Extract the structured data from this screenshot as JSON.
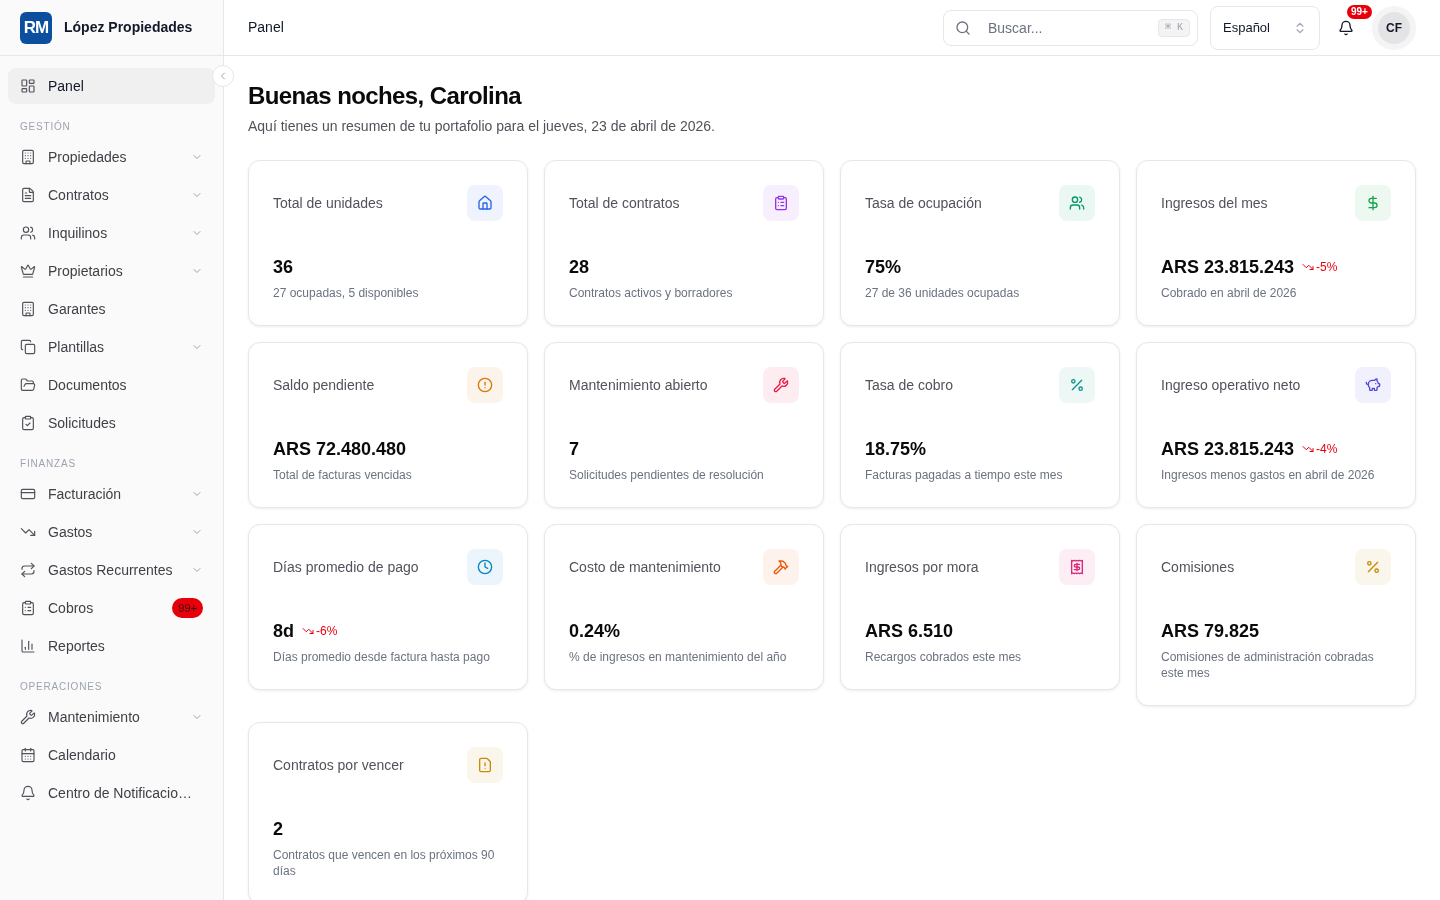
{
  "sidebar": {
    "logo": "RM",
    "brand": "López Propiedades",
    "items": [
      {
        "label": "Panel",
        "selected": true,
        "expandable": false
      }
    ],
    "sections": [
      {
        "title": "GESTIÓN",
        "items": [
          {
            "label": "Propiedades",
            "selected": false,
            "expandable": true
          },
          {
            "label": "Contratos",
            "selected": false,
            "expandable": true
          },
          {
            "label": "Inquilinos",
            "selected": false,
            "expandable": true
          },
          {
            "label": "Propietarios",
            "selected": false,
            "expandable": true
          },
          {
            "label": "Garantes",
            "selected": false,
            "expandable": false
          },
          {
            "label": "Plantillas",
            "selected": false,
            "expandable": true
          },
          {
            "label": "Documentos",
            "selected": false,
            "expandable": false
          },
          {
            "label": "Solicitudes",
            "selected": false,
            "expandable": false
          }
        ]
      },
      {
        "title": "FINANZAS",
        "items": [
          {
            "label": "Facturación",
            "selected": false,
            "expandable": true
          },
          {
            "label": "Gastos",
            "selected": false,
            "expandable": true
          },
          {
            "label": "Gastos Recurrentes",
            "selected": false,
            "expandable": true
          },
          {
            "label": "Cobros",
            "selected": false,
            "expandable": false,
            "badge": "99+"
          },
          {
            "label": "Reportes",
            "selected": false,
            "expandable": false
          }
        ]
      },
      {
        "title": "OPERACIONES",
        "items": [
          {
            "label": "Mantenimiento",
            "selected": false,
            "expandable": true
          },
          {
            "label": "Calendario",
            "selected": false,
            "expandable": false
          },
          {
            "label": "Centro de Notificacio…",
            "selected": false,
            "expandable": false
          }
        ]
      }
    ]
  },
  "header": {
    "breadcrumb": "Panel",
    "search": {
      "placeholder": "Buscar...",
      "shortcut": "⌘ K"
    },
    "language": {
      "value": "Español"
    },
    "notifications": {
      "badge": "99+"
    },
    "user": {
      "initials": "CF"
    }
  },
  "greeting": {
    "title": "Buenas noches, Carolina",
    "subtitle": "Aquí tienes un resumen de tu portafolio para el jueves, 23 de abril de 2026."
  },
  "cards": [
    {
      "title": "Total de unidades",
      "value": "36",
      "description": "27 ocupadas, 5 disponibles",
      "color": "#2563eb"
    },
    {
      "title": "Total de contratos",
      "value": "28",
      "description": "Contratos activos y borradores",
      "color": "#9333ea"
    },
    {
      "title": "Tasa de ocupación",
      "value": "75%",
      "description": "27 de 36 unidades ocupadas",
      "color": "#059669"
    },
    {
      "title": "Ingresos del mes",
      "value": "ARS 23.815.243",
      "trend": {
        "text": "-5%",
        "negative": true
      },
      "description": "Cobrado en abril de 2026",
      "color": "#16a34a"
    },
    {
      "title": "Saldo pendiente",
      "value": "ARS 72.480.480",
      "description": "Total de facturas vencidas",
      "color": "#d97706"
    },
    {
      "title": "Mantenimiento abierto",
      "value": "7",
      "description": "Solicitudes pendientes de resolución",
      "color": "#e11d48"
    },
    {
      "title": "Tasa de cobro",
      "value": "18.75%",
      "description": "Facturas pagadas a tiempo este mes",
      "color": "#0d9488"
    },
    {
      "title": "Ingreso operativo neto",
      "value": "ARS 23.815.243",
      "trend": {
        "text": "-4%",
        "negative": true
      },
      "description": "Ingresos menos gastos en abril de 2026",
      "color": "#4f46e5"
    },
    {
      "title": "Días promedio de pago",
      "value": "8d",
      "trend": {
        "text": "-6%",
        "negative": true
      },
      "description": "Días promedio desde factura hasta pago",
      "color": "#0284c7"
    },
    {
      "title": "Costo de mantenimiento",
      "value": "0.24%",
      "description": "% de ingresos en mantenimiento del año",
      "color": "#ea580c"
    },
    {
      "title": "Ingresos por mora",
      "value": "ARS 6.510",
      "description": "Recargos cobrados este mes",
      "color": "#db2777"
    },
    {
      "title": "Comisiones",
      "value": "ARS 79.825",
      "description": "Comisiones de administración cobradas este mes",
      "color": "#ca8a04"
    },
    {
      "title": "Contratos por vencer",
      "value": "2",
      "description": "Contratos que vencen en los próximos 90 días",
      "color": "#ca8a04"
    }
  ]
}
